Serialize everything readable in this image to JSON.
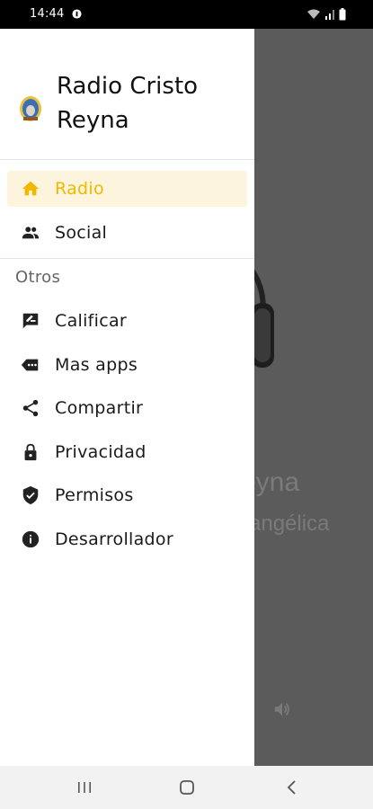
{
  "status": {
    "time": "14:44"
  },
  "drawer": {
    "app_name": "Radio Cristo Reyna",
    "primary_items": [
      {
        "label": "Radio",
        "icon": "home-icon",
        "active": true
      },
      {
        "label": "Social",
        "icon": "people-icon",
        "active": false
      }
    ],
    "section_title": "Otros",
    "other_items": [
      {
        "label": "Calificar",
        "icon": "rate-review-icon"
      },
      {
        "label": "Mas apps",
        "icon": "more-apps-icon"
      },
      {
        "label": "Compartir",
        "icon": "share-icon"
      },
      {
        "label": "Privacidad",
        "icon": "lock-icon"
      },
      {
        "label": "Permisos",
        "icon": "shield-check-icon"
      },
      {
        "label": "Desarrollador",
        "icon": "info-icon"
      }
    ]
  },
  "background_screen": {
    "title_fragment": "eyna",
    "subtitle_fragment": "angélica"
  },
  "colors": {
    "accent": "#f2b800",
    "active_bg": "#fdf4dd",
    "scrim": "#5b5b5b"
  }
}
